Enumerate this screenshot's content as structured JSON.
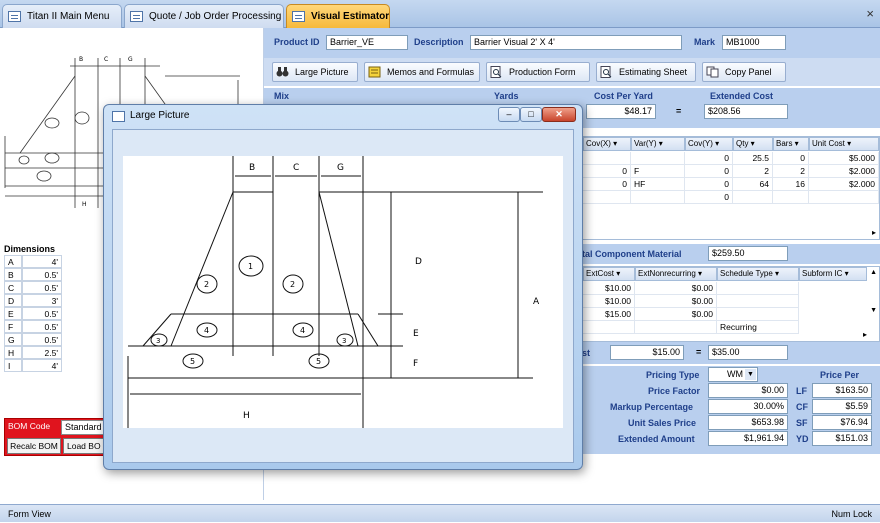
{
  "tabs": [
    {
      "label": "Titan II Main Menu",
      "active": false
    },
    {
      "label": "Quote / Job Order Processing",
      "active": false
    },
    {
      "label": "Visual Estimator",
      "active": true
    }
  ],
  "close_glyph": "×",
  "header": {
    "product_id_label": "Product ID",
    "product_id": "Barrier_VE",
    "description_label": "Description",
    "description": "Barrier Visual 2' X 4'",
    "mark_label": "Mark",
    "mark": "MB1000"
  },
  "toolbar": {
    "large_picture": "Large Picture",
    "memos": "Memos and Formulas",
    "production_form": "Production Form",
    "estimating_sheet": "Estimating Sheet",
    "copy_panel": "Copy Panel"
  },
  "mix": {
    "mix_label": "Mix",
    "yards_label": "Yards",
    "cost_per_yard_label": "Cost Per Yard",
    "cost_per_yard": "$48.17",
    "equals": "=",
    "extended_cost_label": "Extended Cost",
    "extended_cost": "$208.56"
  },
  "upper_grid": {
    "headers": [
      "Cov(X) ▾",
      "Var(Y) ▾",
      "Cov(Y) ▾",
      "Qty ▾",
      "Bars ▾",
      "Unit Cost ▾"
    ],
    "rows": [
      [
        "",
        "",
        "0",
        "25.5",
        "0",
        "$5.000"
      ],
      [
        "0",
        "F",
        "0",
        "2",
        "2",
        "$2.000"
      ],
      [
        "0",
        "HF",
        "0",
        "64",
        "16",
        "$2.000"
      ],
      [
        "",
        "",
        "0",
        "",
        "",
        ""
      ]
    ]
  },
  "component": {
    "label": "tal Component Material",
    "value": "$259.50",
    "headers": [
      "ExtCost ▾",
      "ExtNonrecurring ▾",
      "Schedule Type ▾",
      "Subform IC ▾"
    ],
    "rows": [
      [
        "$10.00",
        "$0.00",
        ""
      ],
      [
        "$10.00",
        "$0.00",
        ""
      ],
      [
        "$15.00",
        "$0.00",
        ""
      ],
      [
        "",
        "",
        "Recurring"
      ]
    ]
  },
  "cost_row": {
    "label": "st",
    "value1": "$15.00",
    "equals": "=",
    "value2": "$35.00"
  },
  "pricing": {
    "pricing_type_label": "Pricing Type",
    "pricing_type": "WM",
    "price_factor_label": "Price Factor",
    "price_factor": "$0.00",
    "markup_label": "Markup Percentage",
    "markup": "30.00%",
    "unit_sales_label": "Unit Sales Price",
    "unit_sales": "$653.98",
    "extended_amount_label": "Extended Amount",
    "extended_amount": "$1,961.94",
    "price_per_label": "Price Per",
    "per": [
      {
        "unit": "LF",
        "value": "$163.50"
      },
      {
        "unit": "CF",
        "value": "$5.59"
      },
      {
        "unit": "SF",
        "value": "$76.94"
      },
      {
        "unit": "YD",
        "value": "$151.03"
      }
    ]
  },
  "dimensions": {
    "title": "Dimensions",
    "rows": [
      {
        "k": "A",
        "v": "4'"
      },
      {
        "k": "B",
        "v": "0.5'"
      },
      {
        "k": "C",
        "v": "0.5'"
      },
      {
        "k": "D",
        "v": "3'"
      },
      {
        "k": "E",
        "v": "0.5'"
      },
      {
        "k": "F",
        "v": "0.5'"
      },
      {
        "k": "G",
        "v": "0.5'"
      },
      {
        "k": "H",
        "v": "2.5'"
      },
      {
        "k": "I",
        "v": "4'"
      }
    ]
  },
  "bom": {
    "code_label": "BOM Code",
    "code_value": "Standard",
    "recalc": "Recalc BOM",
    "load": "Load BO"
  },
  "modal": {
    "title": "Large Picture"
  },
  "drawing": {
    "dims": [
      "B",
      "C",
      "G",
      "D",
      "A",
      "E",
      "F",
      "H"
    ],
    "parts": [
      "1",
      "2",
      "2",
      "3",
      "3",
      "4",
      "4",
      "5",
      "5"
    ],
    "small_dims": [
      "B",
      "C",
      "G",
      "H"
    ]
  },
  "status": {
    "left": "Form View",
    "right": "Num Lock"
  },
  "colors": {
    "accent": "#1f3f8a",
    "tab_active": "#f6b93b",
    "band": "#b9cfee",
    "bom_red": "#e0141e"
  }
}
